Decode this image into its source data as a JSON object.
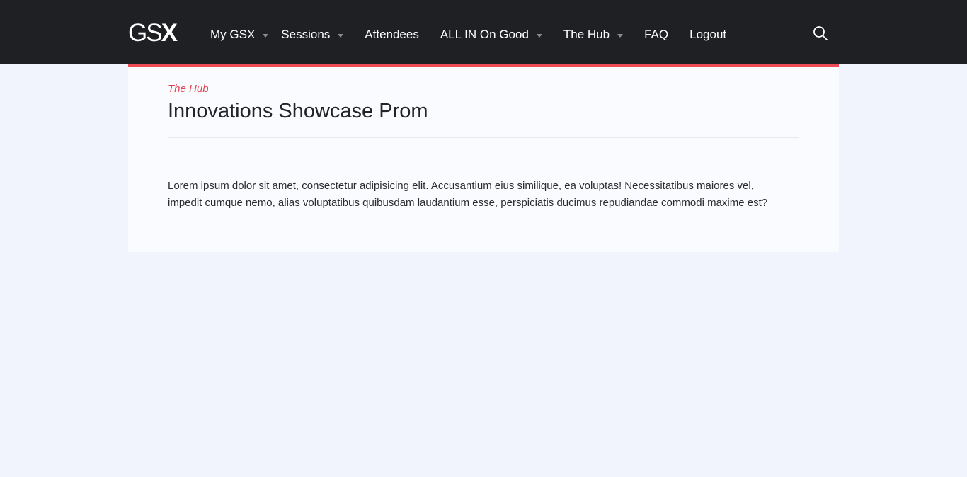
{
  "header": {
    "logo": {
      "gs": "GS",
      "x": "X"
    },
    "nav": [
      {
        "label": "My GSX",
        "has_dropdown": true
      },
      {
        "label": "Sessions",
        "has_dropdown": true
      },
      {
        "label": "Attendees",
        "has_dropdown": false
      },
      {
        "label": "ALL IN On Good",
        "has_dropdown": true
      },
      {
        "label": "The Hub",
        "has_dropdown": true
      },
      {
        "label": "FAQ",
        "has_dropdown": false
      },
      {
        "label": "Logout",
        "has_dropdown": false
      }
    ],
    "search_icon": "search-icon"
  },
  "page": {
    "eyebrow": "The Hub",
    "title": "Innovations Showcase Prom",
    "body_line1": "Lorem ipsum dolor sit amet, consectetur adipisicing elit. Accusantium eius similique, ea voluptas! Necessitatibus maiores vel,",
    "body_line2": "impedit cumque nemo, alias voluptatibus quibusdam laudantium esse, perspiciatis ducimus repudiandae commodi maxime est?"
  },
  "colors": {
    "header_bg": "#1f2024",
    "accent": "#ef4b56",
    "page_bg": "#f2f4fd"
  }
}
